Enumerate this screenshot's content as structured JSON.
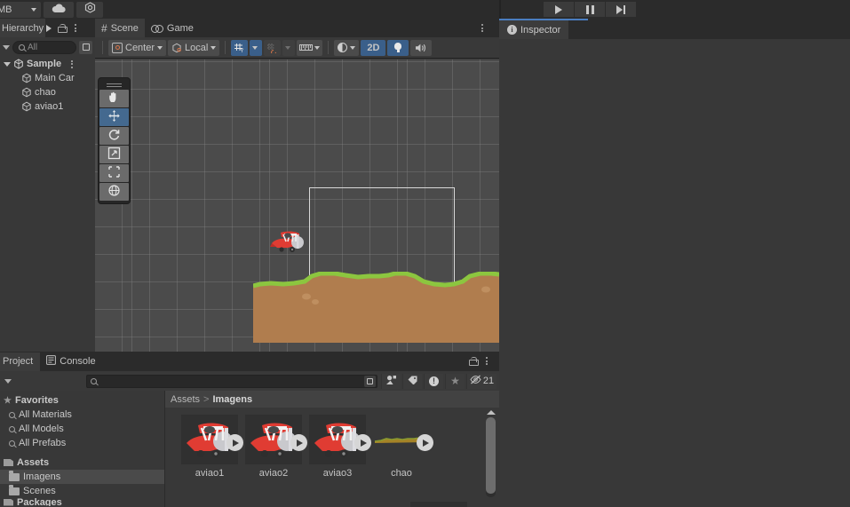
{
  "top_toolbar": {
    "account_label": "MB",
    "cloud_icon": "cloud-icon",
    "services_icon": "services-hex-icon",
    "play_icon": "play-icon",
    "pause_icon": "pause-icon",
    "step_icon": "step-icon"
  },
  "hierarchy": {
    "tab_label": "Hierarchy",
    "search_placeholder": "All",
    "scene_name": "Sample",
    "items": [
      {
        "label": "Main Car",
        "icon": "cube-icon"
      },
      {
        "label": "chao",
        "icon": "cube-icon"
      },
      {
        "label": "aviao1",
        "icon": "cube-icon"
      }
    ]
  },
  "scene": {
    "tabs": [
      {
        "label": "Scene",
        "icon": "hash-icon",
        "active": true
      },
      {
        "label": "Game",
        "icon": "gamepad-icon",
        "active": false
      }
    ],
    "toolbar": {
      "pivot_label": "Center",
      "handle_label": "Local",
      "grid_toggle": "grid-y-icon",
      "snap_toggle": "snap-increment-icon",
      "ruler_toggle": "ruler-icon",
      "shading_label": "shading-mode-icon",
      "mode_2d_label": "2D",
      "lighting_icon": "light-bulb-icon",
      "audio_icon": "audio-icon"
    },
    "tools": [
      {
        "name": "hand-tool",
        "active": false
      },
      {
        "name": "move-tool",
        "active": true
      },
      {
        "name": "rotate-tool",
        "active": false
      },
      {
        "name": "scale-tool",
        "active": false
      },
      {
        "name": "rect-tool",
        "active": false
      },
      {
        "name": "transform-tool",
        "active": false
      }
    ],
    "colors": {
      "viewport_bg": "#4b4b4b",
      "grid_line": "#8c8c8c",
      "terrain_top": "#8cc63f",
      "terrain_body": "#b07d4e",
      "plane_red": "#e03c33",
      "camera_bounds": "#d8d8d8",
      "accent_blue": "#3a5f8a"
    }
  },
  "inspector": {
    "tab_label": "Inspector",
    "icon": "info-icon",
    "accent": "#4a7dc0"
  },
  "project": {
    "tabs": [
      {
        "label": "Project",
        "active": true
      },
      {
        "label": "Console",
        "active": false,
        "icon": "console-icon"
      }
    ],
    "search_placeholder": "",
    "filters": [
      {
        "name": "search-in-scene-icon"
      },
      {
        "name": "filter-by-type-icon"
      },
      {
        "name": "filter-by-label-icon"
      },
      {
        "name": "warning-filter-icon"
      },
      {
        "name": "favorite-star-icon"
      },
      {
        "name": "hidden-items-icon",
        "count": "21"
      }
    ],
    "tree": {
      "favorites_label": "Favorites",
      "favorites": [
        "All Materials",
        "All Models",
        "All Prefabs"
      ],
      "assets_label": "Assets",
      "folders": [
        {
          "label": "Imagens",
          "selected": true
        },
        {
          "label": "Scenes",
          "selected": false
        }
      ],
      "packages_label": "Packages"
    },
    "breadcrumb": {
      "root": "Assets",
      "separator": ">",
      "current": "Imagens"
    },
    "assets": [
      {
        "label": "aviao1",
        "kind": "sprite-plane"
      },
      {
        "label": "aviao2",
        "kind": "sprite-plane"
      },
      {
        "label": "aviao3",
        "kind": "sprite-plane"
      },
      {
        "label": "chao",
        "kind": "sprite-terrain"
      }
    ]
  }
}
